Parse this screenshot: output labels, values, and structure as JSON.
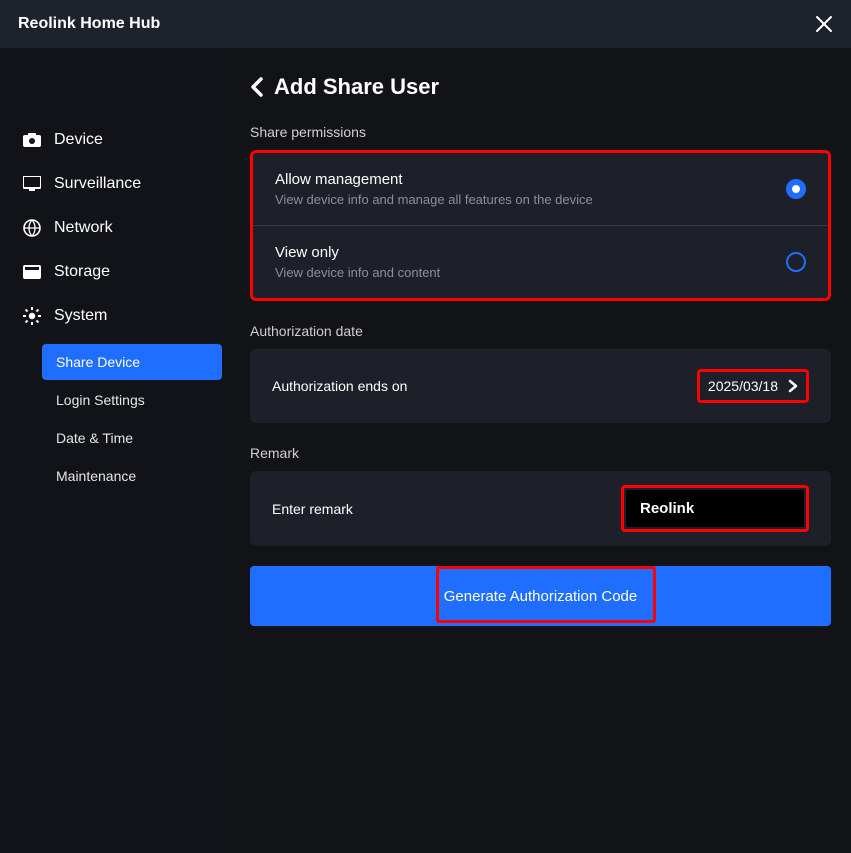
{
  "titlebar": {
    "title": "Reolink Home Hub"
  },
  "sidebar": {
    "items": [
      {
        "label": "Device"
      },
      {
        "label": "Surveillance"
      },
      {
        "label": "Network"
      },
      {
        "label": "Storage"
      },
      {
        "label": "System"
      }
    ],
    "system_sub": [
      {
        "label": "Share Device",
        "active": true
      },
      {
        "label": "Login Settings"
      },
      {
        "label": "Date & Time"
      },
      {
        "label": "Maintenance"
      }
    ]
  },
  "main": {
    "page_title": "Add Share User",
    "share_permissions_label": "Share permissions",
    "permissions": [
      {
        "title": "Allow management",
        "desc": "View device info and manage all features on the device",
        "checked": true
      },
      {
        "title": "View only",
        "desc": "View device info and content",
        "checked": false
      }
    ],
    "authorization_date_label": "Authorization date",
    "auth_ends_label": "Authorization ends on",
    "auth_ends_value": "2025/03/18",
    "remark_label": "Remark",
    "remark_placeholder": "Enter remark",
    "remark_value": "Reolink",
    "generate_button": "Generate Authorization Code"
  }
}
